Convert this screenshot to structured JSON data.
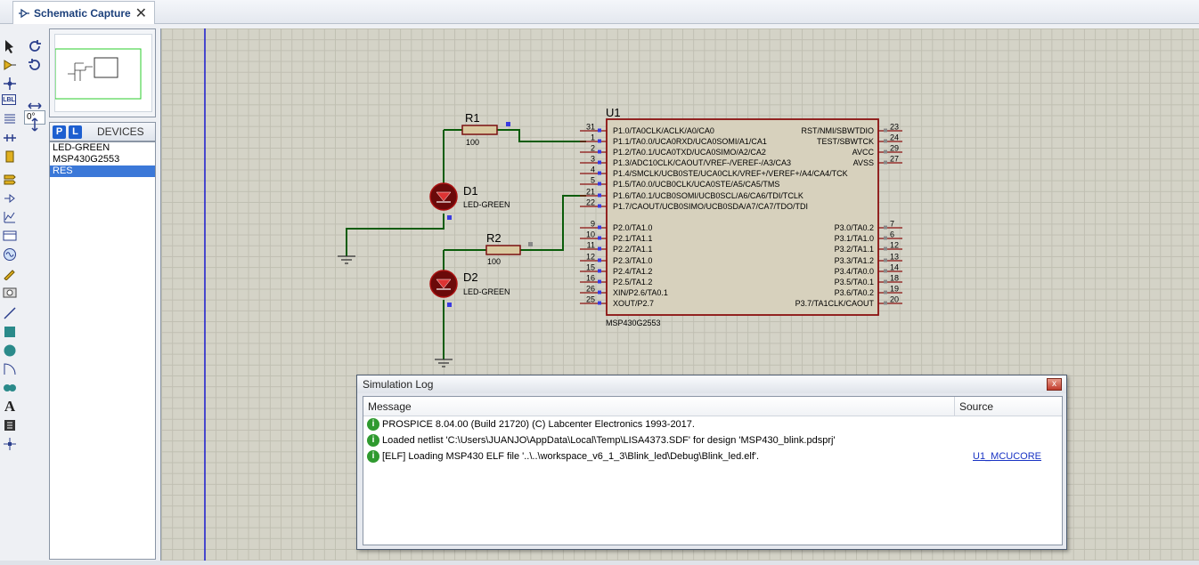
{
  "tab": {
    "title": "Schematic Capture",
    "close": "✕"
  },
  "toolbar": {
    "angle": "0°",
    "label_icon_text": "LBL"
  },
  "devices": {
    "p": "P",
    "l": "L",
    "header": "DEVICES",
    "items": [
      {
        "label": "LED-GREEN"
      },
      {
        "label": "MSP430G2553"
      },
      {
        "label": "RES"
      }
    ]
  },
  "schematic": {
    "r1": {
      "ref": "R1",
      "value": "100"
    },
    "r2": {
      "ref": "R2",
      "value": "100"
    },
    "d1": {
      "ref": "D1",
      "value": "LED-GREEN"
    },
    "d2": {
      "ref": "D2",
      "value": "LED-GREEN"
    },
    "u1": {
      "ref": "U1",
      "part": "MSP430G2553",
      "left_pins": [
        {
          "num": "31",
          "name": "P1.0/TA0CLK/ACLK/A0/CA0"
        },
        {
          "num": "1",
          "name": "P1.1/TA0.0/UCA0RXD/UCA0SOMI/A1/CA1"
        },
        {
          "num": "2",
          "name": "P1.2/TA0.1/UCA0TXD/UCA0SIMO/A2/CA2"
        },
        {
          "num": "3",
          "name": "P1.3/ADC10CLK/CAOUT/VREF-/VEREF-/A3/CA3"
        },
        {
          "num": "4",
          "name": "P1.4/SMCLK/UCB0STE/UCA0CLK/VREF+/VEREF+/A4/CA4/TCK"
        },
        {
          "num": "5",
          "name": "P1.5/TA0.0/UCB0CLK/UCA0STE/A5/CA5/TMS"
        },
        {
          "num": "21",
          "name": "P1.6/TA0.1/UCB0SOMI/UCB0SCL/A6/CA6/TDI/TCLK"
        },
        {
          "num": "22",
          "name": "P1.7/CAOUT/UCB0SIMO/UCB0SDA/A7/CA7/TDO/TDI"
        },
        {
          "num": "9",
          "name": "P2.0/TA1.0"
        },
        {
          "num": "10",
          "name": "P2.1/TA1.1"
        },
        {
          "num": "11",
          "name": "P2.2/TA1.1"
        },
        {
          "num": "12",
          "name": "P2.3/TA1.0"
        },
        {
          "num": "15",
          "name": "P2.4/TA1.2"
        },
        {
          "num": "16",
          "name": "P2.5/TA1.2"
        },
        {
          "num": "26",
          "name": "XIN/P2.6/TA0.1"
        },
        {
          "num": "25",
          "name": "XOUT/P2.7"
        }
      ],
      "right_pins": [
        {
          "num": "23",
          "name": "RST/NMI/SBWTDIO"
        },
        {
          "num": "24",
          "name": "TEST/SBWTCK"
        },
        {
          "num": "29",
          "name": "AVCC"
        },
        {
          "num": "27",
          "name": "AVSS"
        },
        {
          "num": "7",
          "name": "P3.0/TA0.2"
        },
        {
          "num": "6",
          "name": "P3.1/TA1.0"
        },
        {
          "num": "12",
          "name": "P3.2/TA1.1"
        },
        {
          "num": "13",
          "name": "P3.3/TA1.2"
        },
        {
          "num": "14",
          "name": "P3.4/TA0.0"
        },
        {
          "num": "18",
          "name": "P3.5/TA0.1"
        },
        {
          "num": "19",
          "name": "P3.6/TA0.2"
        },
        {
          "num": "20",
          "name": "P3.7/TA1CLK/CAOUT"
        }
      ]
    }
  },
  "simlog": {
    "title": "Simulation Log",
    "close": "x",
    "col_message": "Message",
    "col_source": "Source",
    "rows": [
      {
        "icon": "i",
        "message": "PROSPICE 8.04.00 (Build 21720) (C) Labcenter Electronics 1993-2017.",
        "source": ""
      },
      {
        "icon": "i",
        "message": "Loaded netlist 'C:\\Users\\JUANJO\\AppData\\Local\\Temp\\LISA4373.SDF' for design 'MSP430_blink.pdsprj'",
        "source": ""
      },
      {
        "icon": "i",
        "message": "[ELF] Loading MSP430 ELF file '..\\..\\workspace_v6_1_3\\Blink_led\\Debug\\Blink_led.elf'.",
        "source": "U1_MCUCORE"
      }
    ]
  }
}
